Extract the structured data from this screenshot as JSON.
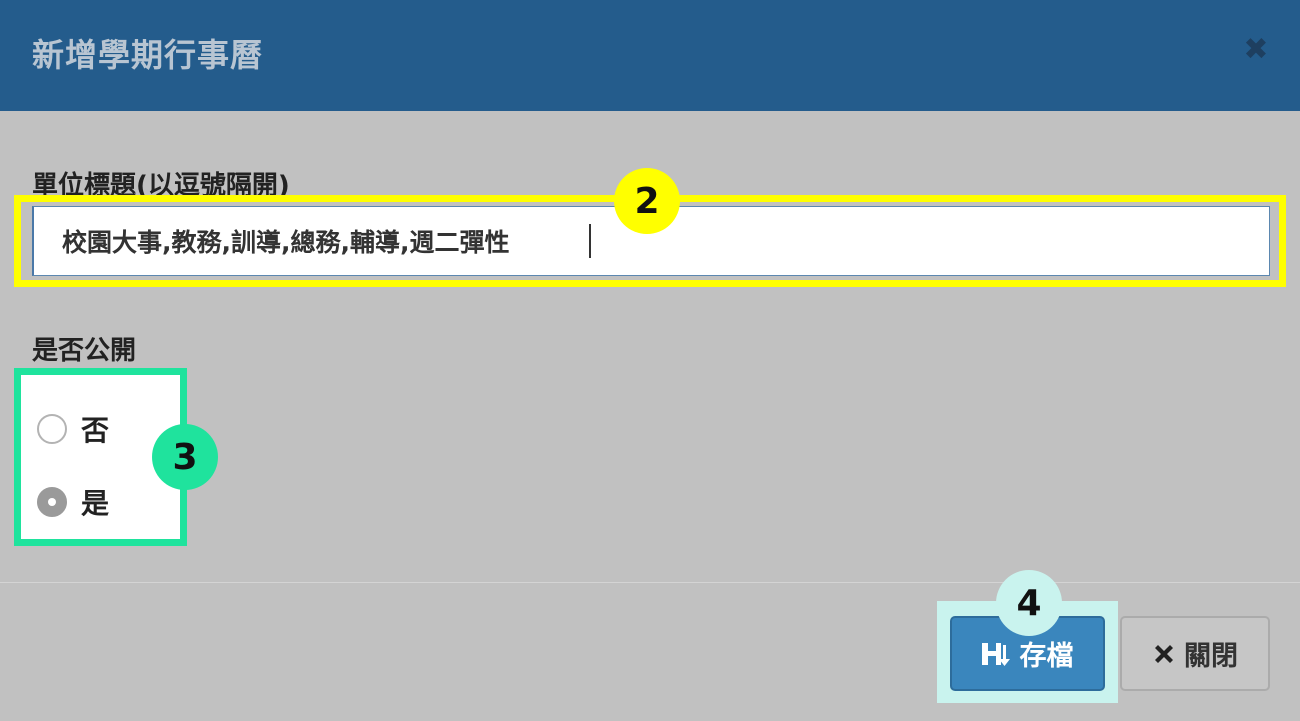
{
  "dialog": {
    "title": "新增學期行事曆",
    "close_glyph": "✖"
  },
  "form": {
    "units_label": "單位標題(以逗號隔開)",
    "units_value": "校園大事,教務,訓導,總務,輔導,週二彈性",
    "public_label": "是否公開",
    "public_options": [
      {
        "label": "否",
        "checked": false
      },
      {
        "label": "是",
        "checked": true
      }
    ]
  },
  "footer": {
    "save_label": "存檔",
    "close_label": "關閉"
  },
  "annotations": {
    "badge_2": "2",
    "badge_3": "3",
    "badge_4": "4"
  },
  "colors": {
    "header": "#245c8c",
    "overlay": "#c1c1c1",
    "highlight_yellow": "#ffff00",
    "highlight_green": "#1fe39d",
    "highlight_mint": "#c9f3ee",
    "save_button": "#3a86bd"
  },
  "icons": {
    "close": "close-icon",
    "save": "save-icon",
    "button_close": "times-icon"
  }
}
